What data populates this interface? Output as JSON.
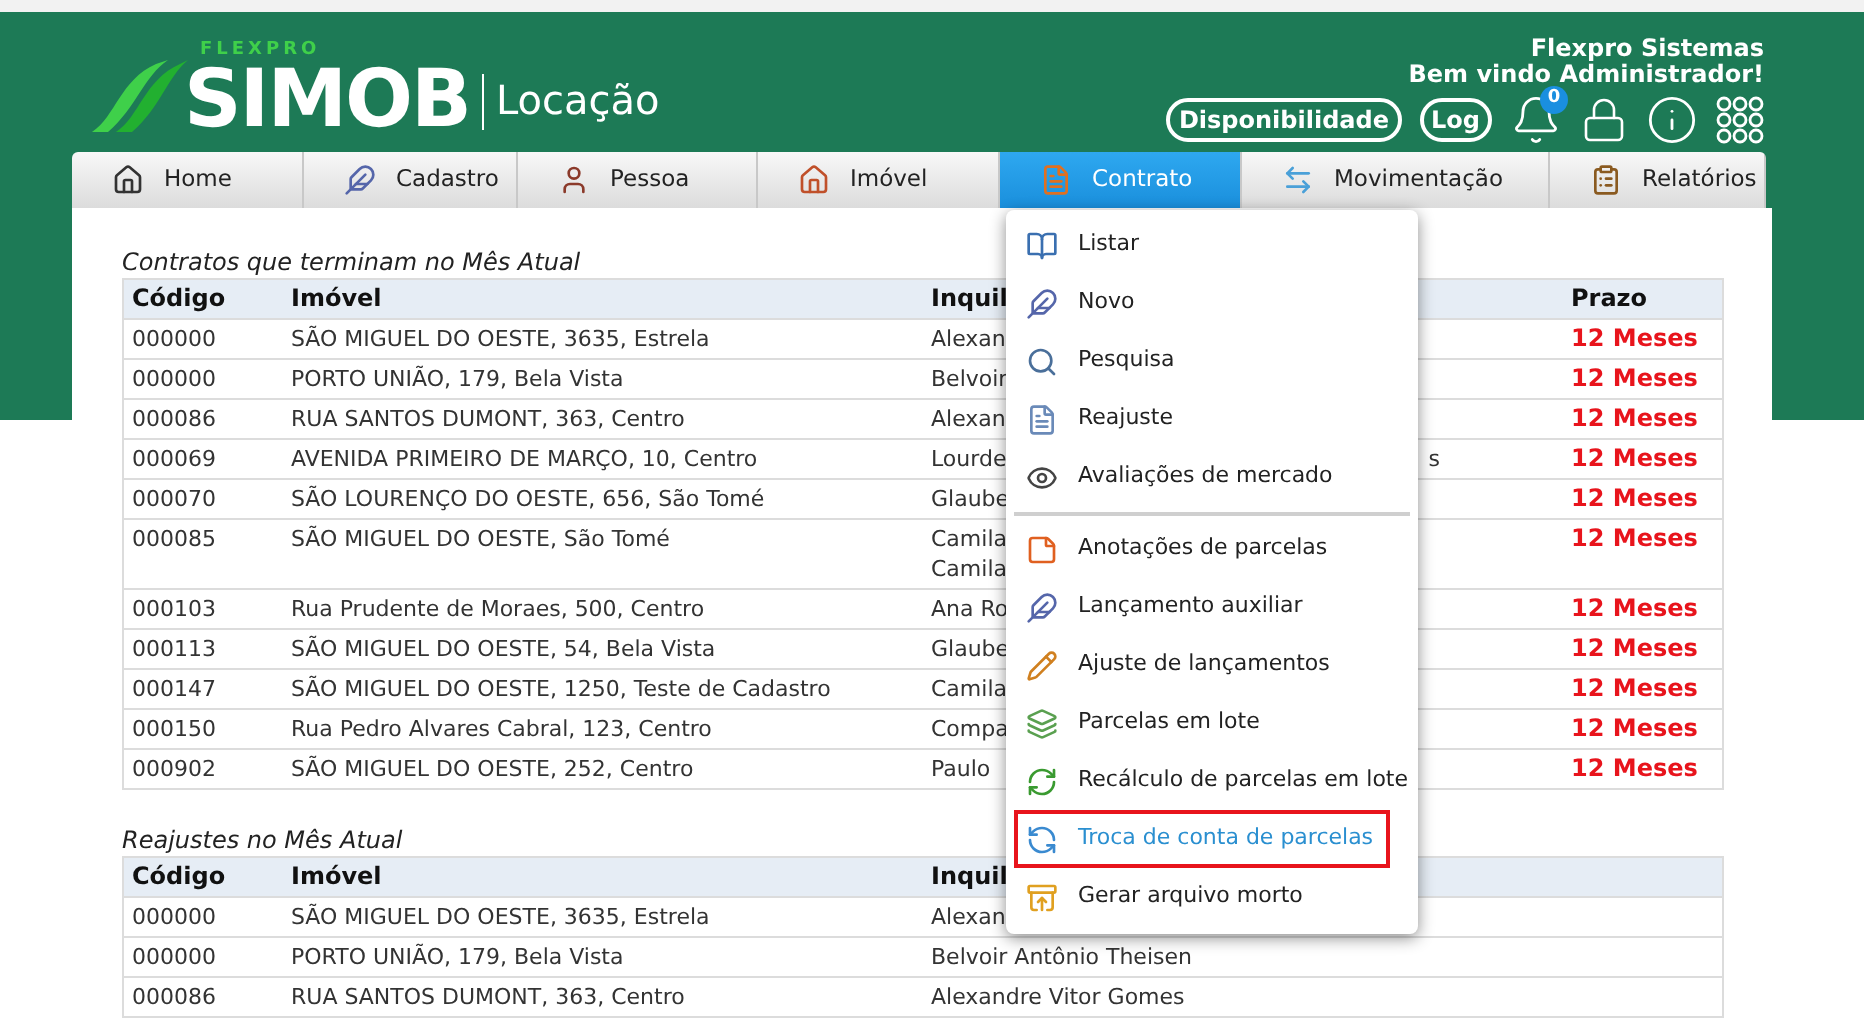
{
  "header": {
    "brand_small": "FLEXPRO",
    "brand": "SIMOB",
    "product": "Locação",
    "company": "Flexpro Sistemas",
    "welcome": "Bem vindo Administrador!",
    "buttons": [
      "Disponibilidade",
      "Log"
    ],
    "notification_count": "0"
  },
  "nav": [
    {
      "label": "Home",
      "kind": "home",
      "selected": false
    },
    {
      "label": "Cadastro",
      "kind": "feather",
      "selected": false
    },
    {
      "label": "Pessoa",
      "kind": "person",
      "selected": false
    },
    {
      "label": "Imóvel",
      "kind": "house",
      "selected": false
    },
    {
      "label": "Contrato",
      "kind": "document",
      "selected": true
    },
    {
      "label": "Movimentação",
      "kind": "transfer",
      "selected": false
    },
    {
      "label": "Relatórios",
      "kind": "clipboard",
      "selected": false
    }
  ],
  "contract_menu": {
    "sections": [
      {
        "items": [
          {
            "label": "Listar",
            "kind": "book",
            "selected": false
          },
          {
            "label": "Novo",
            "kind": "feather",
            "selected": false
          },
          {
            "label": "Pesquisa",
            "kind": "search",
            "selected": false
          },
          {
            "label": "Reajuste",
            "kind": "page",
            "selected": false
          },
          {
            "label": "Avaliações de mercado",
            "kind": "eye",
            "selected": false
          }
        ]
      },
      {
        "items": [
          {
            "label": "Anotações de parcelas",
            "kind": "note",
            "selected": false
          },
          {
            "label": "Lançamento auxiliar",
            "kind": "feather",
            "selected": false
          },
          {
            "label": "Ajuste de lançamentos",
            "kind": "pencil",
            "selected": false
          },
          {
            "label": "Parcelas em lote",
            "kind": "batch",
            "selected": false
          },
          {
            "label": "Recálculo de parcelas em lote",
            "kind": "recalc",
            "selected": false
          },
          {
            "label": "Troca de conta de parcelas",
            "kind": "swap",
            "selected": true
          },
          {
            "label": "Gerar arquivo morto",
            "kind": "archive",
            "selected": false
          }
        ]
      }
    ]
  },
  "tables": [
    {
      "title": "Contratos que terminam no Mês Atual",
      "columns": [
        "Código",
        "Imóvel",
        "Inquil",
        "Prazo"
      ],
      "rows": [
        {
          "code": "000000",
          "property": "SÃO MIGUEL DO OESTE, 3635, Estrela",
          "tenant": "Alexan",
          "term": "12 Meses"
        },
        {
          "code": "000000",
          "property": "PORTO UNIÃO, 179, Bela Vista",
          "tenant": "Belvoir",
          "term": "12 Meses"
        },
        {
          "code": "000086",
          "property": "RUA SANTOS DUMONT, 363, Centro",
          "tenant": "Alexan",
          "term": "12 Meses"
        },
        {
          "code": "000069",
          "property": "AVENIDA PRIMEIRO DE MARÇO, 10, Centro",
          "tenant": "Lourde",
          "column_4": "s",
          "term": "12 Meses"
        },
        {
          "code": "000070",
          "property": "SÃO LOURENÇO DO OESTE, 656, São Tomé",
          "tenant": "Glaube",
          "term": "12 Meses"
        },
        {
          "code": "000085",
          "property": "SÃO MIGUEL DO OESTE, São Tomé",
          "tenant": "Camila\nCamila",
          "term": "12 Meses"
        },
        {
          "code": "000103",
          "property": "Rua Prudente de Moraes, 500, Centro",
          "tenant": "Ana Ro",
          "term": "12 Meses"
        },
        {
          "code": "000113",
          "property": "SÃO MIGUEL DO OESTE, 54, Bela Vista",
          "tenant": "Glaube",
          "term": "12 Meses"
        },
        {
          "code": "000147",
          "property": "SÃO MIGUEL DO OESTE, 1250, Teste de Cadastro",
          "tenant": "Camila",
          "term": "12 Meses"
        },
        {
          "code": "000150",
          "property": "Rua Pedro Alvares Cabral, 123, Centro",
          "tenant": "Compa",
          "term": "12 Meses"
        },
        {
          "code": "000902",
          "property": "SÃO MIGUEL DO OESTE, 252, Centro",
          "tenant": "Paulo",
          "term": "12 Meses"
        }
      ]
    },
    {
      "title": "Reajustes no Mês Atual",
      "columns": [
        "Código",
        "Imóvel",
        "Inquil"
      ],
      "rows": [
        {
          "code": "000000",
          "property": "SÃO MIGUEL DO OESTE, 3635, Estrela",
          "tenant": "Alexan"
        },
        {
          "code": "000000",
          "property": "PORTO UNIÃO, 179, Bela Vista",
          "tenant": "Belvoir Antônio Theisen"
        },
        {
          "code": "000086",
          "property": "RUA SANTOS DUMONT, 363, Centro",
          "tenant": "Alexandre Vitor Gomes"
        }
      ]
    }
  ]
}
